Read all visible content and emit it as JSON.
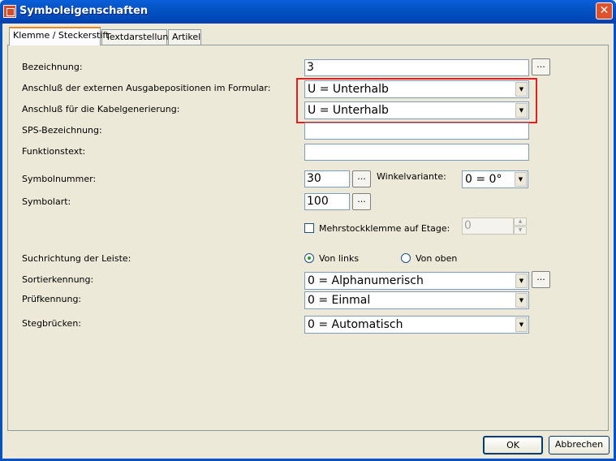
{
  "window": {
    "title": "Symboleigenschaften",
    "close_glyph": "✕"
  },
  "tabs": [
    {
      "label": "Klemme / Steckerstift"
    },
    {
      "label": "Textdarstellung"
    },
    {
      "label": "Artikel"
    }
  ],
  "form": {
    "bezeichnung": {
      "label": "Bezeichnung:",
      "value": "3",
      "dots": "..."
    },
    "anschluss_ausgabe": {
      "label": "Anschluß der externen Ausgabepositionen im Formular:",
      "value": "U = Unterhalb"
    },
    "anschluss_kabel": {
      "label": "Anschluß für die Kabelgenerierung:",
      "value": "U = Unterhalb"
    },
    "sps": {
      "label": "SPS-Bezeichnung:",
      "value": ""
    },
    "funktionstext": {
      "label": "Funktionstext:",
      "value": ""
    },
    "symbolnummer": {
      "label": "Symbolnummer:",
      "value": "30",
      "dots": "..."
    },
    "winkelvariante": {
      "label": "Winkelvariante:",
      "value": "0 = 0°"
    },
    "symbolart": {
      "label": "Symbolart:",
      "value": "100",
      "dots": "..."
    },
    "mehrstock": {
      "label": "Mehrstockklemme auf Etage:",
      "checked": false,
      "value": "0"
    },
    "suchrichtung": {
      "label": "Suchrichtung der Leiste:",
      "opt1": "Von links",
      "opt2": "Von oben",
      "selected": "Von links"
    },
    "sortierkennung": {
      "label": "Sortierkennung:",
      "value": "0 = Alphanumerisch",
      "dots": "..."
    },
    "pruefkennung": {
      "label": "Prüfkennung:",
      "value": "0 = Einmal"
    },
    "stegbruecken": {
      "label": "Stegbrücken:",
      "value": "0 = Automatisch"
    }
  },
  "buttons": {
    "ok": "OK",
    "cancel": "Abbrechen"
  },
  "colors": {
    "highlight": "#e02020",
    "titlebar": "#0453c4"
  }
}
